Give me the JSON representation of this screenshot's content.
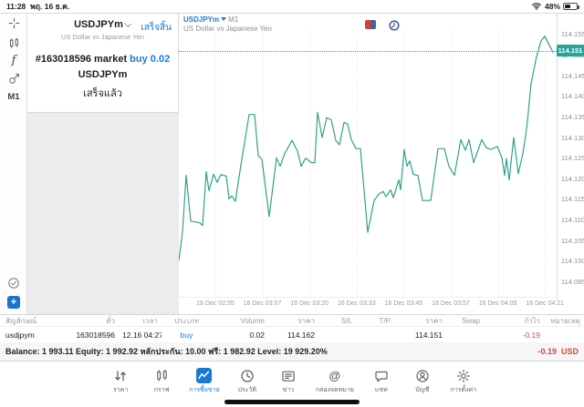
{
  "status_bar": {
    "time": "11:28",
    "date": "พฤ. 16 ธ.ค.",
    "battery_percent": "48%"
  },
  "sidebar": {
    "timeframe_label": "M1"
  },
  "order_panel": {
    "symbol": "USDJPYm",
    "symbol_description": "US Dollar vs Japanese Yen",
    "done_button": "เสร็จสิ้น",
    "order_line_prefix": "#163018596 market ",
    "order_line_action": "buy 0.02",
    "order_symbol": "USDJPYm",
    "order_status": "เสร็จแล้ว"
  },
  "chart_header": {
    "symbol": "USDJPYm",
    "timeframe": "M1",
    "description": "US Dollar vs Japanese Yen"
  },
  "chart_data": {
    "type": "line",
    "symbol": "USDJPYm",
    "timeframe": "M1",
    "title": "US Dollar vs Japanese Yen",
    "line_color": "#2fa287",
    "current_price": 114.151,
    "current_price_label": "114.151",
    "ylim": [
      114.091,
      114.1562
    ],
    "y_ticks": [
      "114.155",
      "114.150",
      "114.145",
      "114.140",
      "114.135",
      "114.130",
      "114.125",
      "114.120",
      "114.115",
      "114.110",
      "114.105",
      "114.100",
      "114.095"
    ],
    "x_ticks": [
      "16 Dec 02:55",
      "16 Dec 03:07",
      "16 Dec 03:20",
      "16 Dec 03:33",
      "16 Dec 03:45",
      "16 Dec 03:57",
      "16 Dec 04:09",
      "16 Dec 04:21"
    ],
    "points": [
      [
        0,
        114.1
      ],
      [
        4,
        114.107
      ],
      [
        8,
        114.1207
      ],
      [
        13,
        114.1096
      ],
      [
        23,
        114.1092
      ],
      [
        26,
        114.1085
      ],
      [
        30,
        114.1216
      ],
      [
        33,
        114.117
      ],
      [
        38,
        114.121
      ],
      [
        42,
        114.119
      ],
      [
        46,
        114.1209
      ],
      [
        52,
        114.1205
      ],
      [
        55,
        114.115
      ],
      [
        58,
        114.1157
      ],
      [
        62,
        114.1144
      ],
      [
        67,
        114.1218
      ],
      [
        73,
        114.13
      ],
      [
        77,
        114.1355
      ],
      [
        83,
        114.1355
      ],
      [
        87,
        114.1255
      ],
      [
        91,
        114.1246
      ],
      [
        99,
        114.1107
      ],
      [
        107,
        114.125
      ],
      [
        111,
        114.1229
      ],
      [
        116,
        114.126
      ],
      [
        124,
        114.1292
      ],
      [
        130,
        114.1266
      ],
      [
        134,
        114.1229
      ],
      [
        139,
        114.1249
      ],
      [
        145,
        114.1238
      ],
      [
        149,
        114.1238
      ],
      [
        152,
        114.136
      ],
      [
        157,
        114.1299
      ],
      [
        162,
        114.1347
      ],
      [
        167,
        114.1342
      ],
      [
        172,
        114.1292
      ],
      [
        176,
        114.1281
      ],
      [
        181,
        114.1336
      ],
      [
        185,
        114.1331
      ],
      [
        189,
        114.1294
      ],
      [
        194,
        114.1272
      ],
      [
        199,
        114.1272
      ],
      [
        207,
        114.1069
      ],
      [
        214,
        114.1146
      ],
      [
        219,
        114.1161
      ],
      [
        224,
        114.1168
      ],
      [
        227,
        114.1155
      ],
      [
        232,
        114.1172
      ],
      [
        235,
        114.1153
      ],
      [
        241,
        114.1196
      ],
      [
        243,
        114.1172
      ],
      [
        247,
        114.127
      ],
      [
        250,
        114.1229
      ],
      [
        253,
        114.1242
      ],
      [
        257,
        114.1209
      ],
      [
        262,
        114.1207
      ],
      [
        267,
        114.1146
      ],
      [
        276,
        114.1146
      ],
      [
        284,
        114.1272
      ],
      [
        291,
        114.1272
      ],
      [
        296,
        114.1229
      ],
      [
        302,
        114.1207
      ],
      [
        309,
        114.1294
      ],
      [
        314,
        114.1268
      ],
      [
        318,
        114.1294
      ],
      [
        323,
        114.1238
      ],
      [
        332,
        114.1294
      ],
      [
        337,
        114.1274
      ],
      [
        342,
        114.127
      ],
      [
        349,
        114.1277
      ],
      [
        354,
        114.125
      ],
      [
        357,
        114.1207
      ],
      [
        359,
        114.1248
      ],
      [
        362,
        114.1196
      ],
      [
        367,
        114.1299
      ],
      [
        372,
        114.1211
      ],
      [
        377,
        114.126
      ],
      [
        380,
        114.1303
      ],
      [
        382,
        114.1338
      ],
      [
        386,
        114.143
      ],
      [
        392,
        114.1495
      ],
      [
        397,
        114.1534
      ],
      [
        401,
        114.1545
      ],
      [
        405,
        114.1527
      ],
      [
        410,
        114.1506
      ]
    ]
  },
  "positions_table": {
    "columns": [
      "สัญลักษณ์",
      "ตั๋ว",
      "เวลา",
      "ประเภท",
      "Volume",
      "ราคา",
      "S/L",
      "T/P",
      "ราคา",
      "Swap",
      "กำไร",
      "หมายเหตุ"
    ],
    "rows": [
      {
        "symbol": "usdjpym",
        "ticket": "163018596",
        "time": "12.16 04:27",
        "type": "buy",
        "volume": "0.02",
        "price_open": "114.162",
        "sl": "",
        "tp": "",
        "price_current": "114.151",
        "swap": "",
        "profit": "-0.19",
        "notes": ""
      }
    ]
  },
  "account_bar": {
    "summary": "Balance: 1 993.11 Equity: 1 992.92 หลักประกัน: 10.00 ฟรี: 1 982.92 Level: 19 929.20%",
    "profit": "-0.19",
    "currency": "USD"
  },
  "tab_bar": {
    "items": [
      {
        "label": "ราคา",
        "icon": "quotes-icon",
        "active": false
      },
      {
        "label": "กราฟ",
        "icon": "chart-icon",
        "active": false
      },
      {
        "label": "การซื้อขาย",
        "icon": "trade-icon",
        "active": true
      },
      {
        "label": "ประวัติ",
        "icon": "history-icon",
        "active": false
      },
      {
        "label": "ข่าว",
        "icon": "news-icon",
        "active": false
      },
      {
        "label": "กล่องจดหมาย",
        "icon": "mailbox-icon",
        "active": false
      },
      {
        "label": "แชท",
        "icon": "chat-icon",
        "active": false
      },
      {
        "label": "บัญชี",
        "icon": "account-icon",
        "active": false
      },
      {
        "label": "การตั้งค่า",
        "icon": "settings-icon",
        "active": false
      }
    ]
  }
}
